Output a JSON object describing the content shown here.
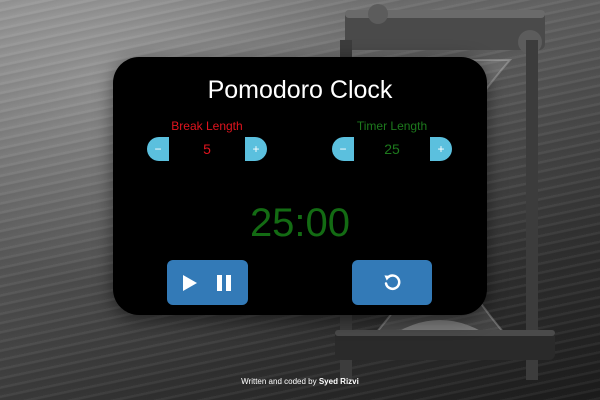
{
  "app": {
    "title": "Pomodoro Clock"
  },
  "break": {
    "label": "Break Length",
    "value": "5",
    "minus": "−",
    "plus": "+"
  },
  "timer": {
    "label": "Timer Length",
    "value": "25",
    "minus": "−",
    "plus": "+"
  },
  "display": {
    "time": "25:00"
  },
  "controls": {
    "playpause_icons": [
      "play-icon",
      "pause-icon"
    ],
    "reset_icon": "reset-icon"
  },
  "footer": {
    "prefix": "Written and coded by ",
    "author": "Syed Rizvi"
  },
  "colors": {
    "break_accent": "#e0141e",
    "timer_accent": "#1d7a1d",
    "display": "#136b13",
    "stepper": "#5bc0de",
    "control_button": "#337ab7",
    "card": "#000000"
  }
}
